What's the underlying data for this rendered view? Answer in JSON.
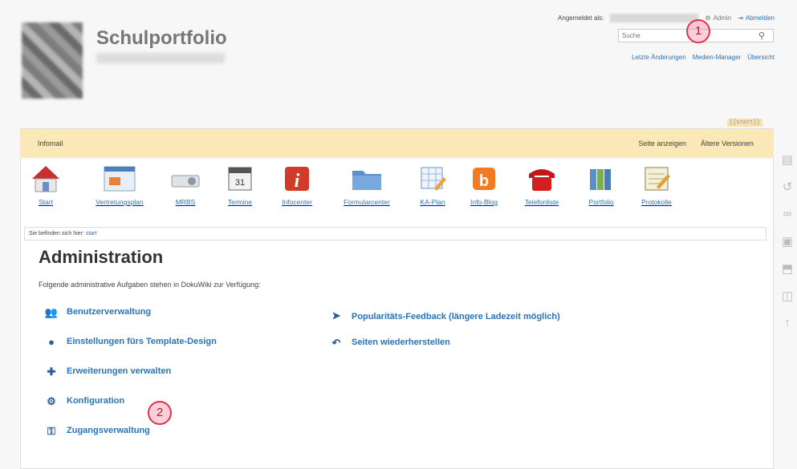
{
  "header": {
    "site_title": "Schulportfolio",
    "logged_in_label": "Angemeldet als:",
    "admin_link": "Admin",
    "logout_link": "Abmelden",
    "search_placeholder": "Suche",
    "tools": [
      "Letzte Änderungen",
      "Medien-Manager",
      "Übersicht"
    ]
  },
  "page_id": "[[start]]",
  "infobar": {
    "left": "Infomail",
    "view_page": "Seite anzeigen",
    "old_versions": "Ältere Versionen"
  },
  "nav": [
    {
      "label": "Start",
      "icon": "home-icon"
    },
    {
      "label": "Vertretungsplan",
      "icon": "schedule-icon"
    },
    {
      "label": "MRBS",
      "icon": "projector-icon"
    },
    {
      "label": "Termine",
      "icon": "calendar-icon"
    },
    {
      "label": "Infocenter",
      "icon": "info-icon"
    },
    {
      "label": "Formularcenter",
      "icon": "folder-icon"
    },
    {
      "label": "KA-Plan",
      "icon": "table-edit-icon"
    },
    {
      "label": "Info-Blog",
      "icon": "blog-icon"
    },
    {
      "label": "Telefonliste",
      "icon": "phone-icon"
    },
    {
      "label": "Portfolio",
      "icon": "binders-icon"
    },
    {
      "label": "Protokolle",
      "icon": "notepad-icon"
    }
  ],
  "breadcrumb": {
    "prefix": "Sie befinden sich hier:",
    "link": "start"
  },
  "admin": {
    "title": "Administration",
    "description": "Folgende administrative Aufgaben stehen in DokuWiki zur Verfügung:",
    "left_items": [
      {
        "label": "Benutzerverwaltung",
        "icon": "users-icon"
      },
      {
        "label": "Einstellungen fürs Template-Design",
        "icon": "palette-icon"
      },
      {
        "label": "Erweiterungen verwalten",
        "icon": "puzzle-icon"
      },
      {
        "label": "Konfiguration",
        "icon": "gear-icon"
      },
      {
        "label": "Zugangsverwaltung",
        "icon": "key-icon"
      }
    ],
    "right_items": [
      {
        "label": "Popularitäts-Feedback (längere Ladezeit möglich)",
        "icon": "send-icon"
      },
      {
        "label": "Seiten wiederherstellen",
        "icon": "undo-icon"
      }
    ]
  },
  "annotations": [
    "1",
    "2"
  ],
  "colors": {
    "link": "#2b73b7",
    "infobar": "#fae8b6",
    "badge": "#e2324f"
  }
}
